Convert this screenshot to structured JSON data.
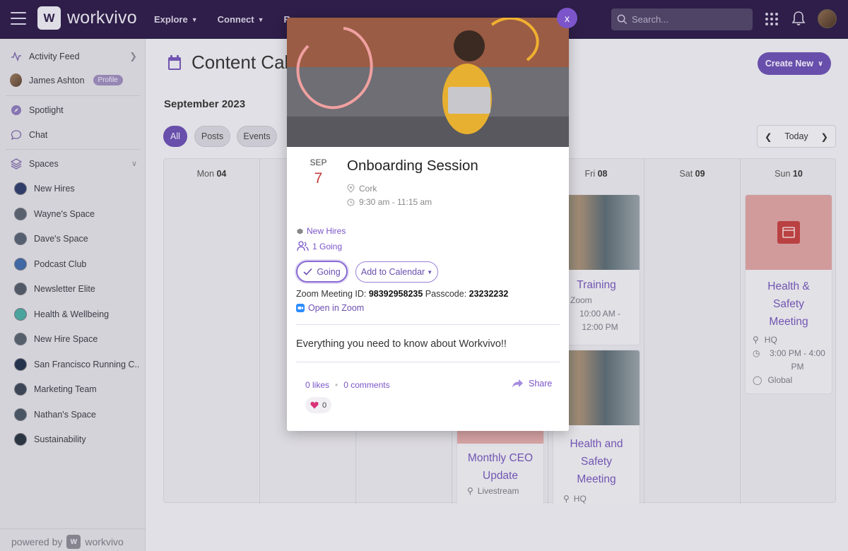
{
  "topbar": {
    "logo_text": "workvivo",
    "logo_mark": "W",
    "nav": [
      {
        "label": "Explore"
      },
      {
        "label": "Connect"
      },
      {
        "label": "Re"
      }
    ],
    "search_placeholder": "Search..."
  },
  "sidebar": {
    "activity_feed": "Activity Feed",
    "user_name": "James Ashton",
    "profile_badge": "Profile",
    "spotlight": "Spotlight",
    "chat": "Chat",
    "spaces_label": "Spaces",
    "spaces": [
      {
        "label": "New Hires",
        "color": "#2f3c6a"
      },
      {
        "label": "Wayne's Space",
        "color": "#5a6270"
      },
      {
        "label": "Dave's Space",
        "color": "#566070"
      },
      {
        "label": "Podcast Club",
        "color": "#3e6aa8"
      },
      {
        "label": "Newsletter Elite",
        "color": "#525a66"
      },
      {
        "label": "Health & Wellbeing",
        "color": "#4aa8a0"
      },
      {
        "label": "New Hire Space",
        "color": "#56606c"
      },
      {
        "label": "San Francisco Running C...",
        "color": "#22304a"
      },
      {
        "label": "Marketing Team",
        "color": "#3a4454"
      },
      {
        "label": "Nathan's Space",
        "color": "#4a5664"
      },
      {
        "label": "Sustainability",
        "color": "#2a3440"
      }
    ],
    "powered_by": "powered by",
    "powered_logo": "workvivo"
  },
  "main": {
    "title": "Content Cal",
    "create_new": "Create New",
    "month": "September 2023",
    "filters": [
      "All",
      "Posts",
      "Events"
    ],
    "today": "Today",
    "days": [
      {
        "dow": "Mon",
        "num": "04"
      },
      {
        "dow": "Fri",
        "num": "08"
      },
      {
        "dow": "Sat",
        "num": "09"
      },
      {
        "dow": "Sun",
        "num": "10"
      }
    ],
    "events": {
      "training": {
        "title": "Training",
        "loc": "Zoom",
        "time": "10:00 AM - 12:00 PM"
      },
      "hs_sun": {
        "title": "Health & Safety Meeting",
        "loc": "HQ",
        "time": "3:00 PM - 4:00 PM",
        "audience": "Global"
      },
      "hs_fri": {
        "title": "Health and Safety Meeting",
        "loc": "HQ"
      },
      "ceo": {
        "title": "Monthly CEO Update",
        "loc": "Livestream"
      }
    }
  },
  "modal": {
    "close": "x",
    "month": "SEP",
    "day": "7",
    "title": "Onboarding Session",
    "location": "Cork",
    "time": "9:30 am - 11:15 am",
    "space": "New Hires",
    "going_count": "1 Going",
    "going_btn": "Going",
    "add_cal": "Add to Calendar",
    "zoom_id_label": "Zoom Meeting ID:",
    "zoom_id": "98392958235",
    "passcode_label": "Passcode:",
    "passcode": "23232232",
    "open_zoom": "Open in Zoom",
    "description": "Everything you need to know about Workvivo!!",
    "likes": "0 likes",
    "comments": "0 comments",
    "share": "Share",
    "reaction_count": "0"
  },
  "colors": {
    "brand": "#2c1b48",
    "accent": "#6a4fb0",
    "date_red": "#c63a3a"
  }
}
